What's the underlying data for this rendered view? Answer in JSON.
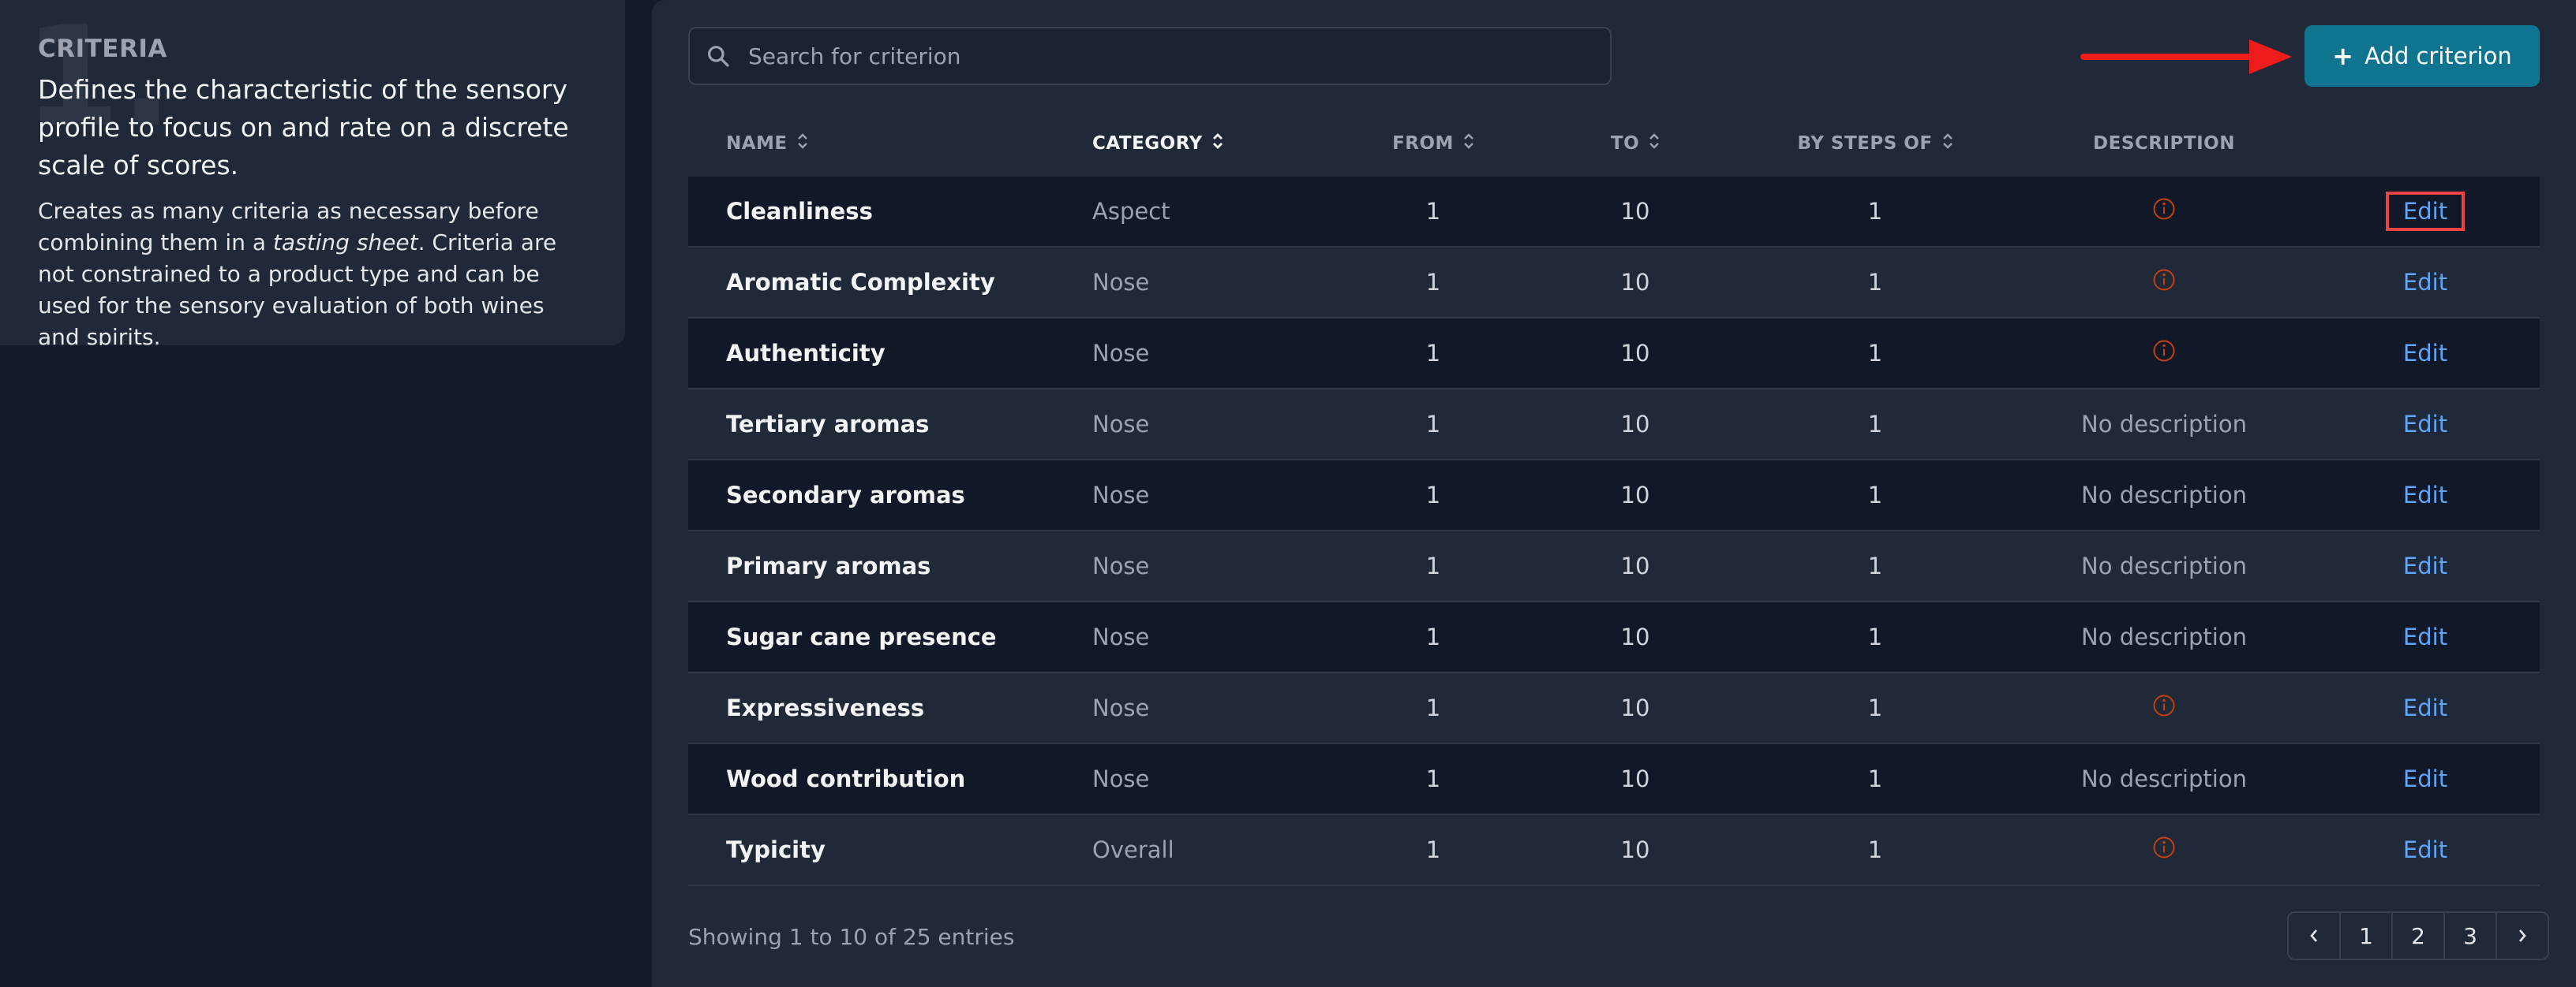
{
  "info": {
    "step": "1.",
    "title": "CRITERIA",
    "lead": "Defines the characteristic of the sensory profile to focus on and rate on a discrete scale of scores.",
    "body_part1": "Creates as many criteria as necessary before combining them in a ",
    "body_emphasis": "tasting sheet",
    "body_part2": ". Criteria are not constrained to a product type and can be used for the sensory evaluation of both wines and spirits."
  },
  "search": {
    "placeholder": "Search for criterion"
  },
  "add_button": {
    "label": "Add criterion"
  },
  "table": {
    "headers": {
      "name": "NAME",
      "category": "CATEGORY",
      "from": "FROM",
      "to": "TO",
      "step": "BY STEPS OF",
      "description": "DESCRIPTION"
    },
    "edit_label": "Edit",
    "rows": [
      {
        "name": "Cleanliness",
        "category": "Aspect",
        "from": "1",
        "to": "10",
        "step": "1",
        "description": ""
      },
      {
        "name": "Aromatic Complexity",
        "category": "Nose",
        "from": "1",
        "to": "10",
        "step": "1",
        "description": ""
      },
      {
        "name": "Authenticity",
        "category": "Nose",
        "from": "1",
        "to": "10",
        "step": "1",
        "description": ""
      },
      {
        "name": "Tertiary aromas",
        "category": "Nose",
        "from": "1",
        "to": "10",
        "step": "1",
        "description": "No description"
      },
      {
        "name": "Secondary aromas",
        "category": "Nose",
        "from": "1",
        "to": "10",
        "step": "1",
        "description": "No description"
      },
      {
        "name": "Primary aromas",
        "category": "Nose",
        "from": "1",
        "to": "10",
        "step": "1",
        "description": "No description"
      },
      {
        "name": "Sugar cane presence",
        "category": "Nose",
        "from": "1",
        "to": "10",
        "step": "1",
        "description": "No description"
      },
      {
        "name": "Expressiveness",
        "category": "Nose",
        "from": "1",
        "to": "10",
        "step": "1",
        "description": ""
      },
      {
        "name": "Wood contribution",
        "category": "Nose",
        "from": "1",
        "to": "10",
        "step": "1",
        "description": "No description"
      },
      {
        "name": "Typicity",
        "category": "Overall",
        "from": "1",
        "to": "10",
        "step": "1",
        "description": ""
      }
    ]
  },
  "footer": {
    "entries_text": "Showing 1 to 10 of 25 entries",
    "pages": [
      "1",
      "2",
      "3"
    ]
  },
  "colors": {
    "accent": "#0e7490",
    "link": "#60a5fa",
    "info_icon": "#c2410c",
    "highlight": "#ef4444"
  }
}
